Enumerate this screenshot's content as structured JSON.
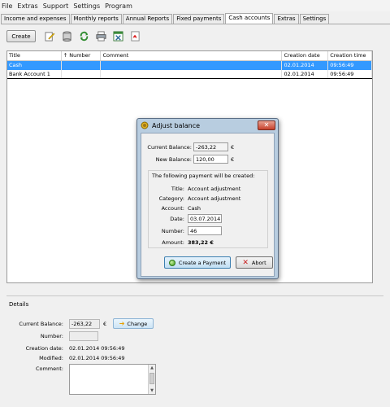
{
  "menu": [
    "File",
    "Extras",
    "Support",
    "Settings",
    "Program"
  ],
  "tabs": [
    "Income and expenses",
    "Monthly reports",
    "Annual Reports",
    "Fixed payments",
    "Cash accounts",
    "Extras",
    "Settings"
  ],
  "active_tab": "Cash accounts",
  "toolbar": {
    "create_label": "Create",
    "icons": [
      "edit-icon",
      "archive-icon",
      "refresh-icon",
      "print-icon",
      "export-excel-icon",
      "export-pdf-icon"
    ]
  },
  "table": {
    "columns": [
      "Title",
      "↑ Number",
      "Comment",
      "Creation date",
      "Creation time"
    ],
    "rows": [
      {
        "title": "Cash",
        "number": "",
        "comment": "",
        "date": "02.01.2014",
        "time": "09:56:49"
      },
      {
        "title": "Bank Account 1",
        "number": "",
        "comment": "",
        "date": "02.01.2014",
        "time": "09:56:49"
      }
    ]
  },
  "details": {
    "title": "Details",
    "current_balance_label": "Current Balance:",
    "current_balance": "-263,22",
    "currency": "€",
    "change_label": "Change",
    "number_label": "Number:",
    "number": "",
    "creation_date_label": "Creation date:",
    "creation_date": "02.01.2014 09:56:49",
    "modified_label": "Modified:",
    "modified": "02.01.2014 09:56:49",
    "comment_label": "Comment:"
  },
  "dialog": {
    "title": "Adjust balance",
    "current_balance_label": "Current Balance:",
    "current_balance": "-263,22",
    "new_balance_label": "New Balance:",
    "new_balance": "120,00",
    "currency": "€",
    "group_title": "The following payment will be created:",
    "title_label": "Title:",
    "title_value": "Account adjustment",
    "category_label": "Category:",
    "category_value": "Account adjustment",
    "account_label": "Account:",
    "account_value": "Cash",
    "date_label": "Date:",
    "date_value": "03.07.2014",
    "number_label": "Number:",
    "number_value": "46",
    "amount_label": "Amount:",
    "amount_value": "383,22 €",
    "create_label": "Create a Payment",
    "abort_label": "Abort",
    "close_glyph": "✕"
  }
}
